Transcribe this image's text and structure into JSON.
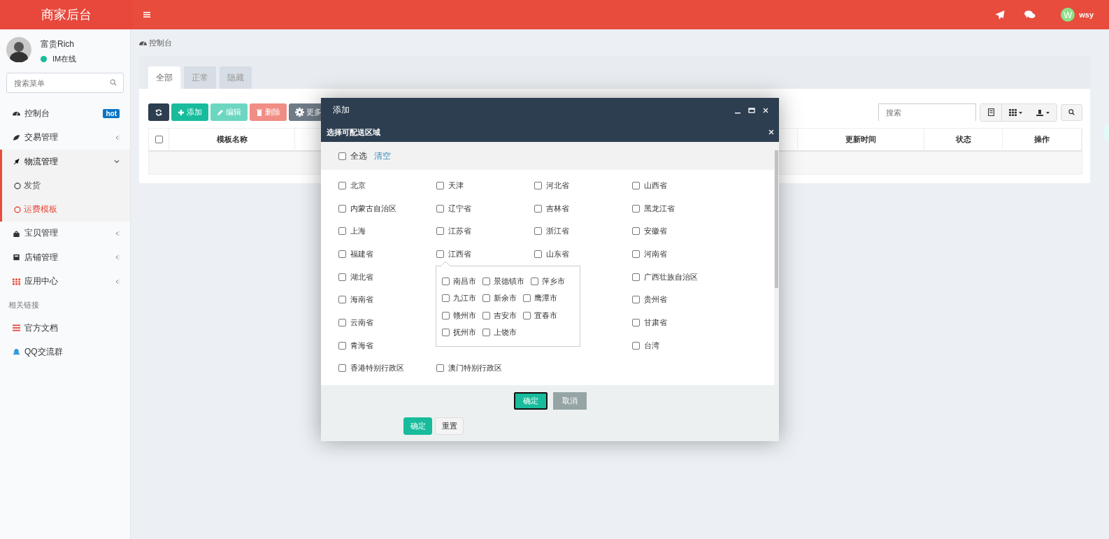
{
  "app": {
    "logo": "商家后台",
    "user": {
      "initial": "W",
      "name": "wsy"
    }
  },
  "sidebar": {
    "profile": {
      "name": "富贵Rich",
      "status": "IM在线",
      "online": true
    },
    "search": {
      "placeholder": "搜索菜单"
    },
    "items": [
      {
        "kind": "link",
        "label": "控制台",
        "badge": "hot"
      },
      {
        "kind": "menu",
        "label": "交易管理",
        "expanded": false
      },
      {
        "kind": "menu",
        "label": "物流管理",
        "expanded": true,
        "children": [
          {
            "label": "发货",
            "selected": false
          },
          {
            "label": "运费模板",
            "selected": true
          }
        ]
      },
      {
        "kind": "menu",
        "label": "宝贝管理",
        "expanded": false
      },
      {
        "kind": "menu",
        "label": "店铺管理",
        "expanded": false
      },
      {
        "kind": "menu",
        "label": "应用中心",
        "expanded": false
      },
      {
        "kind": "header",
        "label": "相关链接"
      },
      {
        "kind": "link",
        "label": "官方文档"
      },
      {
        "kind": "link",
        "label": "QQ交流群"
      }
    ]
  },
  "breadcrumb": "控制台",
  "tabs": [
    {
      "label": "全部",
      "selected": true
    },
    {
      "label": "正常",
      "selected": false
    },
    {
      "label": "隐藏",
      "selected": false
    }
  ],
  "toolbar": {
    "buttons": [
      {
        "kind": "refresh",
        "disabled": false
      },
      {
        "kind": "add",
        "label": "添加",
        "disabled": false
      },
      {
        "kind": "edit",
        "label": "编辑",
        "disabled": true
      },
      {
        "kind": "delete",
        "label": "删除",
        "disabled": true
      },
      {
        "kind": "more",
        "label": "更多",
        "disabled": false
      }
    ],
    "search": {
      "placeholder": "搜索"
    }
  },
  "table": {
    "select_all": {
      "checked": false
    },
    "columns": [
      {
        "label": "模板名称"
      },
      {
        "label": "更新时间"
      },
      {
        "label": "状态"
      },
      {
        "label": "操作"
      }
    ]
  },
  "modal": {
    "title": "添加",
    "subtitle": "选择可配送区域",
    "select_all": {
      "label": "全选",
      "checked": false
    },
    "clear": "清空",
    "provinces": [
      {
        "kind": "option",
        "label": "北京",
        "checked": false
      },
      {
        "kind": "option",
        "label": "天津",
        "checked": false
      },
      {
        "kind": "option",
        "label": "河北省",
        "checked": false
      },
      {
        "kind": "option",
        "label": "山西省",
        "checked": false
      },
      {
        "kind": "option",
        "label": "内蒙古自治区",
        "checked": false
      },
      {
        "kind": "option",
        "label": "辽宁省",
        "checked": false
      },
      {
        "kind": "option",
        "label": "吉林省",
        "checked": false
      },
      {
        "kind": "option",
        "label": "黑龙江省",
        "checked": false
      },
      {
        "kind": "option",
        "label": "上海",
        "checked": false
      },
      {
        "kind": "option",
        "label": "江苏省",
        "checked": false
      },
      {
        "kind": "option",
        "label": "浙江省",
        "checked": false
      },
      {
        "kind": "option",
        "label": "安徽省",
        "checked": false
      },
      {
        "kind": "option",
        "label": "福建省",
        "checked": false
      },
      {
        "kind": "option",
        "label": "江西省",
        "checked": false
      },
      {
        "kind": "option",
        "label": "山东省",
        "checked": false
      },
      {
        "kind": "option",
        "label": "河南省",
        "checked": false
      },
      {
        "kind": "option",
        "label": "湖北省",
        "checked": false
      },
      {
        "kind": "covered"
      },
      {
        "kind": "covered"
      },
      {
        "kind": "option",
        "label": "广西壮族自治区",
        "checked": false
      },
      {
        "kind": "option",
        "label": "海南省",
        "checked": false
      },
      {
        "kind": "covered"
      },
      {
        "kind": "covered"
      },
      {
        "kind": "option",
        "label": "贵州省",
        "checked": false
      },
      {
        "kind": "option",
        "label": "云南省",
        "checked": false
      },
      {
        "kind": "covered"
      },
      {
        "kind": "covered"
      },
      {
        "kind": "option",
        "label": "甘肃省",
        "checked": false
      },
      {
        "kind": "option",
        "label": "青海省",
        "checked": false
      },
      {
        "kind": "covered"
      },
      {
        "kind": "covered"
      },
      {
        "kind": "option",
        "label": "台湾",
        "checked": false
      },
      {
        "kind": "option",
        "label": "香港特别行政区",
        "checked": false
      },
      {
        "kind": "option",
        "label": "澳门特别行政区",
        "checked": false
      }
    ],
    "cities": [
      {
        "label": "南昌市",
        "checked": false
      },
      {
        "label": "景德镇市",
        "checked": false
      },
      {
        "label": "萍乡市",
        "checked": false
      },
      {
        "label": "九江市",
        "checked": false
      },
      {
        "label": "新余市",
        "checked": false
      },
      {
        "label": "鹰潭市",
        "checked": false
      },
      {
        "label": "赣州市",
        "checked": false
      },
      {
        "label": "吉安市",
        "checked": false
      },
      {
        "label": "宜春市",
        "checked": false
      },
      {
        "label": "抚州市",
        "checked": false
      },
      {
        "label": "上饶市",
        "checked": false
      }
    ],
    "buttons": [
      {
        "kind": "primary",
        "label": "确定"
      },
      {
        "kind": "default",
        "label": "取消"
      }
    ],
    "form_buttons": [
      {
        "kind": "primary",
        "label": "确定"
      },
      {
        "kind": "default",
        "label": "重置"
      }
    ]
  }
}
